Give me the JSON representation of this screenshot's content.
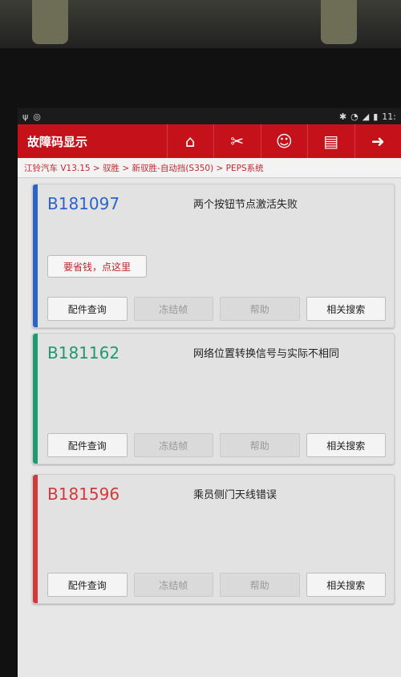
{
  "header": {
    "title": "故障码显示",
    "breadcrumb": "江铃汽车 V13.15 > 驭胜 > 新驭胜-自动挡(S350) > PEPS系统",
    "icons": [
      "home-icon",
      "diagnose-icon",
      "user-icon",
      "print-icon",
      "exit-icon"
    ]
  },
  "status": {
    "time": "11:"
  },
  "tip": "要省钱，点这里",
  "dtcs": [
    {
      "code": "B181097",
      "description": "两个按钮节点激活失败",
      "color": "#2c63c6"
    },
    {
      "code": "B181162",
      "description": "网络位置转换信号与实际不相同",
      "color": "#1e9a6e"
    },
    {
      "code": "B181596",
      "description": "乘员侧门天线错误",
      "color": "#d03a3a"
    }
  ],
  "buttons": {
    "parts": "配件查询",
    "freeze": "冻结帧",
    "help": "帮助",
    "search": "相关搜索"
  }
}
